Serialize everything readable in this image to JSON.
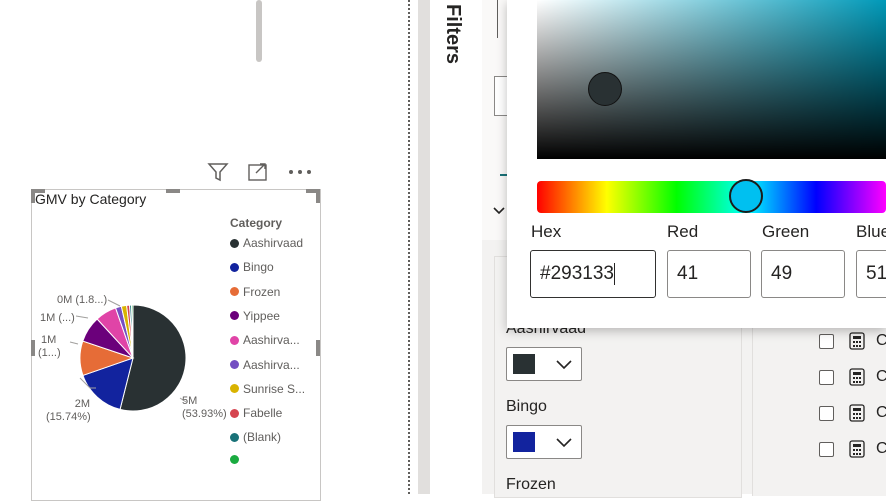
{
  "filters_label": "Filters",
  "visual": {
    "title": "GMV by Category",
    "legend_title": "Category",
    "legend": [
      {
        "label": "Aashirvaad",
        "color": "#293133"
      },
      {
        "label": "Bingo",
        "color": "#12239e"
      },
      {
        "label": "Frozen",
        "color": "#e66c37"
      },
      {
        "label": "Yippee",
        "color": "#6b007b"
      },
      {
        "label": "Aashirva...",
        "color": "#e044a7"
      },
      {
        "label": "Aashirva...",
        "color": "#744ec2"
      },
      {
        "label": "Sunrise S...",
        "color": "#d9b300"
      },
      {
        "label": "Fabelle",
        "color": "#d64550"
      },
      {
        "label": "(Blank)",
        "color": "#197278"
      },
      {
        "label": "",
        "color": "#1aab40"
      }
    ],
    "pie_labels": {
      "big_value": "5M",
      "big_pct": "(53.93%)",
      "bingo_value": "2M",
      "bingo_pct": "(15.74%)",
      "frozen_value": "1M",
      "frozen_pct": "(1...)",
      "yippee": "1M (...)",
      "small": "0M (1.8...)"
    }
  },
  "chart_data": {
    "type": "pie",
    "title": "GMV by Category",
    "categories": [
      "Aashirvaad",
      "Bingo",
      "Frozen",
      "Yippee",
      "Aashirva...",
      "Aashirva...",
      "Sunrise S...",
      "Fabelle",
      "(Blank)",
      ""
    ],
    "values": [
      53.93,
      15.74,
      10.5,
      8.0,
      6.5,
      1.8,
      1.6,
      0.9,
      0.6,
      0.43
    ],
    "colors": [
      "#293133",
      "#12239e",
      "#e66c37",
      "#6b007b",
      "#e044a7",
      "#744ec2",
      "#d9b300",
      "#d64550",
      "#197278",
      "#1aab40"
    ],
    "legend_position": "right"
  },
  "color_picker": {
    "hex_label": "Hex",
    "red_label": "Red",
    "green_label": "Green",
    "blue_label": "Blue",
    "hex_value": "#293133",
    "red_value": "41",
    "green_value": "49",
    "blue_value": "51"
  },
  "format_pane": {
    "categories": [
      {
        "label": "Aashirvaad",
        "color": "#293133"
      },
      {
        "label": "Bingo",
        "color": "#12239e"
      },
      {
        "label": "Frozen"
      }
    ],
    "field_rows": [
      "C",
      "C",
      "C",
      "C"
    ]
  }
}
